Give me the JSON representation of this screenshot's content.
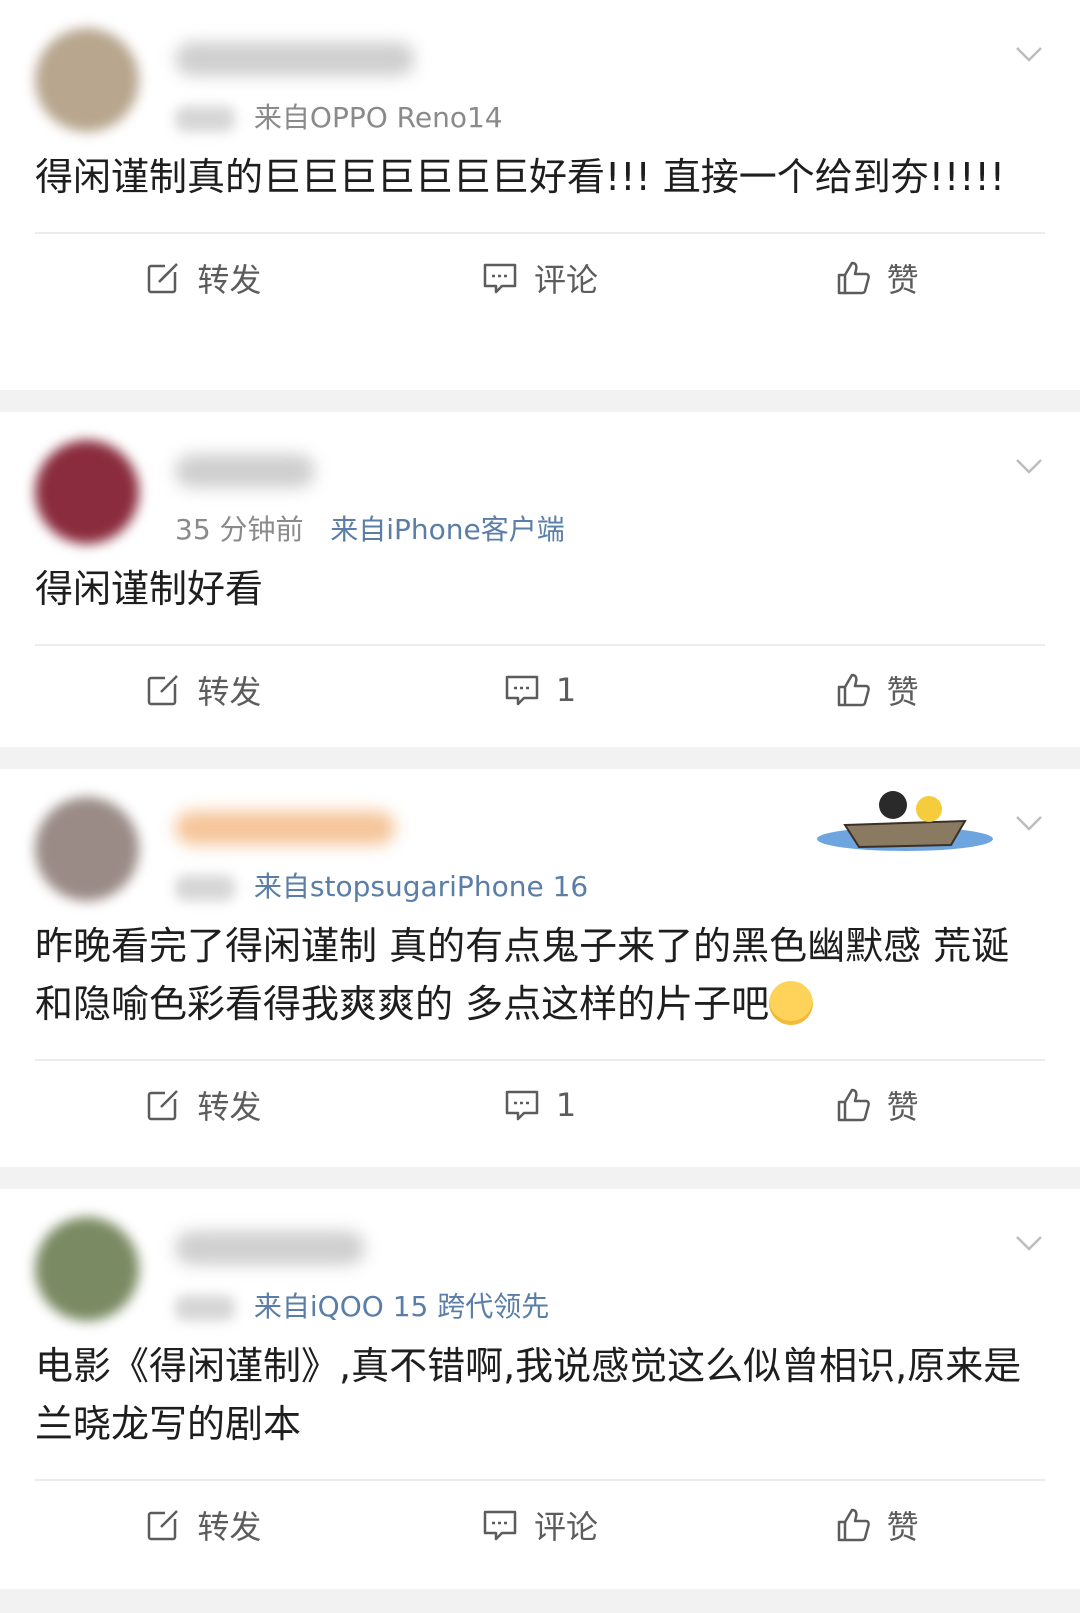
{
  "posts": [
    {
      "meta_time": "",
      "meta_source": "来自OPPO Reno14",
      "text": "得闲谨制真的巨巨巨巨巨巨巨好看!!! 直接一个给到夯!!!!!",
      "actions": {
        "repost": "转发",
        "comment": "评论",
        "like": "赞"
      },
      "avatar_color": "#b8a68e"
    },
    {
      "meta_time": "35 分钟前",
      "meta_source": "来自iPhone客户端",
      "text": "得闲谨制好看",
      "actions": {
        "repost": "转发",
        "comment": "1",
        "like": "赞"
      },
      "avatar_color": "#8a2c3e"
    },
    {
      "meta_time": "",
      "meta_source": "来自stopsugariPhone 16",
      "text": "昨晚看完了得闲谨制 真的有点鬼子来了的黑色幽默感 荒诞和隐喻色彩看得我爽爽的 多点这样的片子吧",
      "actions": {
        "repost": "转发",
        "comment": "1",
        "like": "赞"
      },
      "avatar_color": "#9a8b86"
    },
    {
      "meta_time": "",
      "meta_source": "来自iQOO 15 跨代领先",
      "text": "电影《得闲谨制》,真不错啊,我说感觉这么似曾相识,原来是兰晓龙写的剧本",
      "actions": {
        "repost": "转发",
        "comment": "评论",
        "like": "赞"
      },
      "avatar_color": "#7a8a62"
    }
  ],
  "icons": {
    "repost": "repost-icon",
    "comment": "comment-icon",
    "like": "thumbs-up-icon",
    "menu": "chevron-down-icon"
  }
}
